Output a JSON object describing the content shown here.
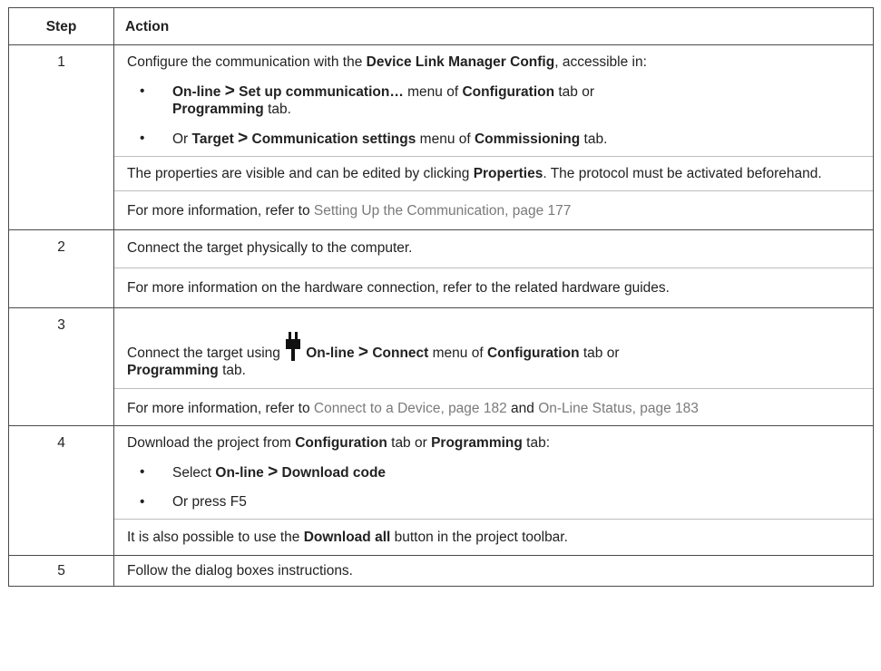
{
  "header": {
    "step": "Step",
    "action": "Action"
  },
  "rows": [
    {
      "step": "1",
      "intro": {
        "a": "Configure the communication with the ",
        "b": "Device Link Manager Config",
        "c": ", accessible in:"
      },
      "bullets": [
        {
          "a": "On-line",
          "gt": ">",
          "b": "Set up communication…",
          "c": " menu of ",
          "d": "Configuration",
          "e": " tab or ",
          "f": "Programming",
          "g": " tab."
        },
        {
          "a": "Or ",
          "b": "Target",
          "gt": ">",
          "c": "Communication settings",
          "d": " menu of ",
          "e": "Commissioning",
          "f": " tab."
        }
      ],
      "props": {
        "a": "The properties are visible and can be edited by clicking ",
        "b": "Properties",
        "c": ". The protocol must be activated beforehand."
      },
      "info": {
        "a": "For more information, refer to ",
        "link": "Setting Up the Communication, page 177"
      }
    },
    {
      "step": "2",
      "line1": "Connect the target physically to the computer.",
      "line2": "For more information on the hardware connection, refer to the related hardware guides."
    },
    {
      "step": "3",
      "main": {
        "a": "Connect the target using ",
        "b": "On-line",
        "gt": ">",
        "c": "Connect",
        "d": " menu of ",
        "e": "Configuration",
        "f": " tab or ",
        "g": "Programming",
        "h": " tab."
      },
      "info": {
        "a": "For more information, refer to ",
        "link1": "Connect to a Device, page 182",
        "b": " and ",
        "link2": "On-Line Status, page 183"
      }
    },
    {
      "step": "4",
      "intro": {
        "a": "Download the project from ",
        "b": "Configuration",
        "c": " tab or ",
        "d": "Programming",
        "e": " tab:"
      },
      "bullets": [
        {
          "a": "Select ",
          "b": "On-line",
          "gt": ">",
          "c": "Download code"
        },
        {
          "a": "Or press F5"
        }
      ],
      "extra": {
        "a": "It is also possible to use the ",
        "b": "Download all",
        "c": " button in the project toolbar."
      }
    },
    {
      "step": "5",
      "line1": "Follow the dialog boxes instructions."
    }
  ],
  "colors": {
    "link": "#7a7a7a",
    "border": "#4a4a4a",
    "divider": "#bdbdbd"
  },
  "icons": {
    "connect": "plug-icon"
  }
}
